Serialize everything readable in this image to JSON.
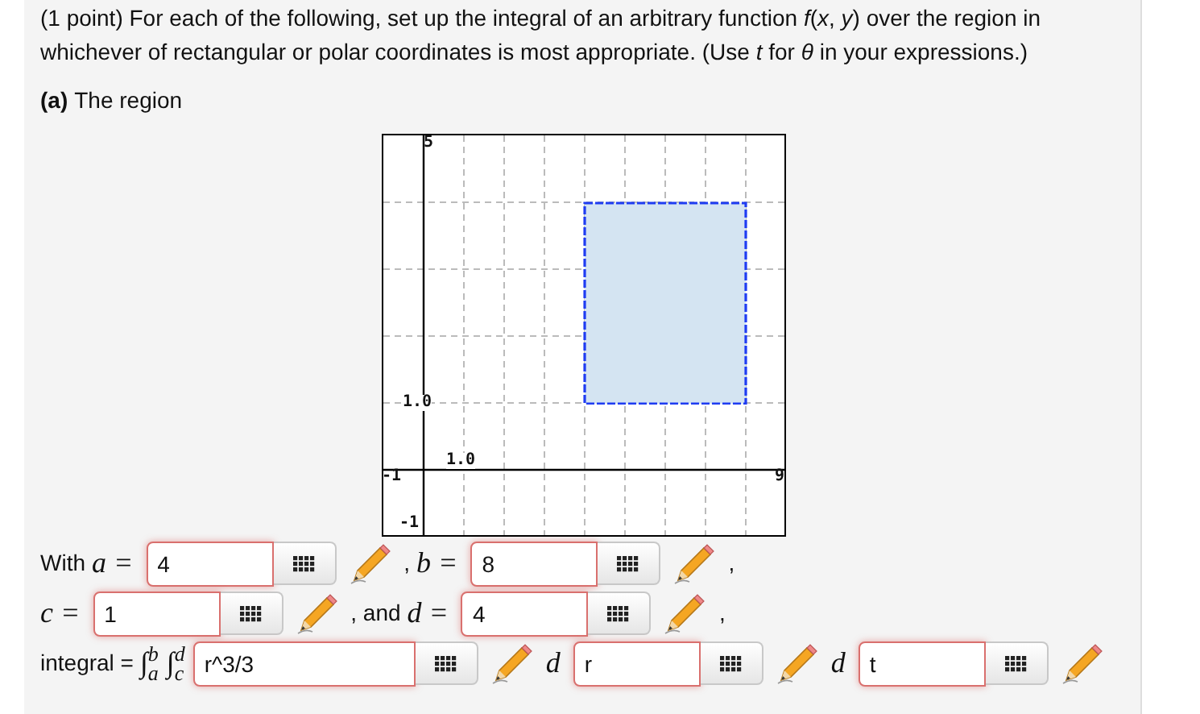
{
  "problem": {
    "intro": "(1 point) For each of the following, set up the integral of an arbitrary function *f*(*x*, *y*) over the region in whichever of rectangular or polar coordinates is most appropriate. (Use *t* for *θ* in your expressions.)",
    "part_label": "(a)",
    "part_text": "The region"
  },
  "graph": {
    "y_max_label": "5",
    "x_min_label": "-1",
    "x_max_label": "9",
    "y_min_label": "-1",
    "x_tick_label": "1.0",
    "y_tick_label": "1.0"
  },
  "answer_rows": [
    [
      {
        "kind": "text",
        "text": "With"
      },
      {
        "kind": "math",
        "text": "a ="
      },
      {
        "kind": "field",
        "value": "4",
        "error": true
      },
      {
        "kind": "keypad"
      },
      {
        "kind": "pencil"
      },
      {
        "kind": "text",
        "text": ","
      },
      {
        "kind": "math",
        "text": "b ="
      },
      {
        "kind": "field",
        "value": "8",
        "error": true
      },
      {
        "kind": "keypad"
      },
      {
        "kind": "pencil"
      },
      {
        "kind": "text",
        "text": ","
      }
    ],
    [
      {
        "kind": "math",
        "text": "c ="
      },
      {
        "kind": "field",
        "value": "1",
        "error": true
      },
      {
        "kind": "keypad"
      },
      {
        "kind": "pencil"
      },
      {
        "kind": "text",
        "text": ", and"
      },
      {
        "kind": "math",
        "text": "d ="
      },
      {
        "kind": "field",
        "value": "4",
        "error": true
      },
      {
        "kind": "keypad"
      },
      {
        "kind": "pencil"
      },
      {
        "kind": "text",
        "text": ","
      }
    ],
    [
      {
        "kind": "text",
        "text": "integral ="
      },
      {
        "kind": "integral",
        "sign": "∫",
        "upper": "b",
        "lower": "a"
      },
      {
        "kind": "integral",
        "sign": "∫",
        "upper": "d",
        "lower": "c"
      },
      {
        "kind": "field",
        "value": "r^3/3",
        "error": true,
        "wide": true
      },
      {
        "kind": "keypad"
      },
      {
        "kind": "pencil"
      },
      {
        "kind": "math",
        "text": "d"
      },
      {
        "kind": "field",
        "value": "r",
        "error": true
      },
      {
        "kind": "keypad"
      },
      {
        "kind": "pencil"
      },
      {
        "kind": "math",
        "text": "d"
      },
      {
        "kind": "field",
        "value": "t",
        "error": true
      },
      {
        "kind": "keypad"
      },
      {
        "kind": "pencil"
      }
    ]
  ]
}
